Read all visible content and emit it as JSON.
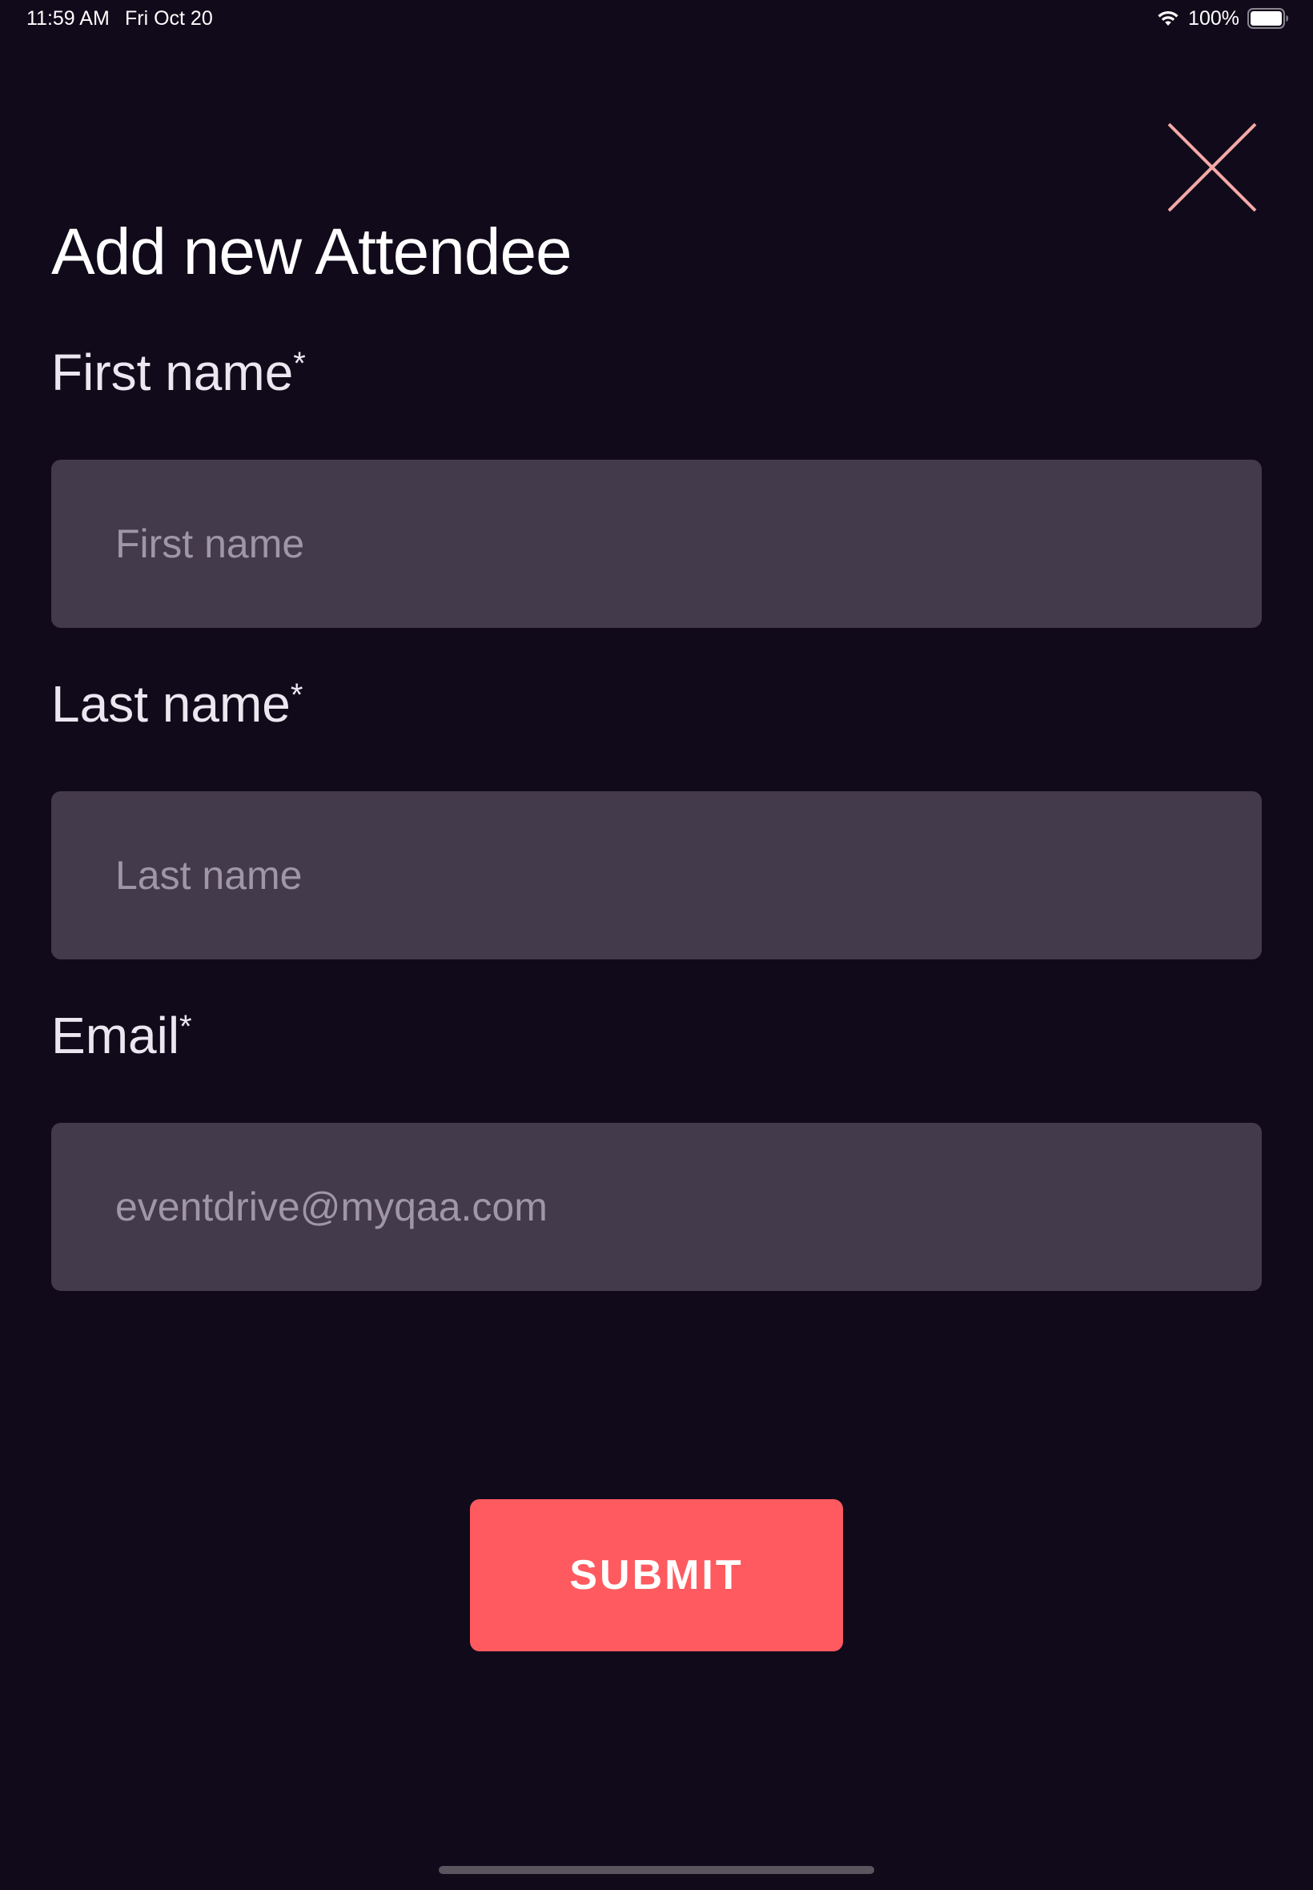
{
  "status_bar": {
    "time": "11:59 AM",
    "date": "Fri Oct 20",
    "battery": "100%",
    "icons": [
      "wifi-icon",
      "battery-icon"
    ]
  },
  "header": {
    "title": "Add new Attendee",
    "close_icon": "close-icon",
    "close_color": "#f4aaa8"
  },
  "form": {
    "first_name": {
      "label": "First name",
      "required_mark": "*",
      "value": "",
      "placeholder": "First name"
    },
    "last_name": {
      "label": "Last name",
      "required_mark": "*",
      "value": "",
      "placeholder": "Last name"
    },
    "email": {
      "label": "Email",
      "required_mark": "*",
      "value": "",
      "placeholder": "eventdrive@myqaa.com"
    },
    "submit_label": "SUBMIT"
  },
  "colors": {
    "background": "#110a1a",
    "input_background": "#433a4b",
    "accent": "#ff5a5f"
  }
}
